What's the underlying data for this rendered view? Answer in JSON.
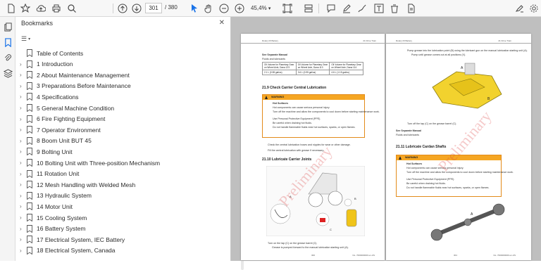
{
  "toolbar": {
    "page_current": "301",
    "page_total": "/ 380",
    "zoom": "45,4%"
  },
  "bookmarks": {
    "title": "Bookmarks",
    "items": [
      {
        "label": "Table of Contents",
        "expandable": false
      },
      {
        "label": "1 Introduction",
        "expandable": true
      },
      {
        "label": "2 About Maintenance Management",
        "expandable": true
      },
      {
        "label": "3 Preparations Before Maintenance",
        "expandable": true
      },
      {
        "label": "4 Specifications",
        "expandable": true
      },
      {
        "label": "5 General Machine Condition",
        "expandable": true
      },
      {
        "label": "6 Fire Fighting Equipment",
        "expandable": true
      },
      {
        "label": "7 Operator Environment",
        "expandable": true
      },
      {
        "label": "8 Boom Unit BUT 45",
        "expandable": true
      },
      {
        "label": "9 Bolting Unit",
        "expandable": true
      },
      {
        "label": "10 Bolting Unit with Three-position Mechanism",
        "expandable": true
      },
      {
        "label": "11 Rotation Unit",
        "expandable": true
      },
      {
        "label": "12 Mesh Handling with Welded Mesh",
        "expandable": true
      },
      {
        "label": "13 Hydraulic System",
        "expandable": true
      },
      {
        "label": "14 Motor Unit",
        "expandable": true
      },
      {
        "label": "15 Cooling System",
        "expandable": true
      },
      {
        "label": "16 Battery System",
        "expandable": true
      },
      {
        "label": "17 Electrical System, IEC Battery",
        "expandable": true
      },
      {
        "label": "18 Electrical System, Canada",
        "expandable": true
      }
    ]
  },
  "doc": {
    "left": {
      "header_left": "Rotary lift Battery",
      "header_right": "21 Drive Train",
      "see_manual": "See Separate Manual",
      "fluids": "Fluids and lubricants",
      "table": [
        [
          "Oil Volume for Planetary Gear on Wheel Axle, Dana 123",
          "Oil Volume for Planetary Gear on Wheel Axle, Dana 113",
          "Oil Volume for Planetary Gear on Wheel Axle, Dana 114"
        ],
        [
          "2.1 L (0.55 gal/us)",
          "3.6 L (0.95 gal/us)",
          "4.6 L (1.15 gal/us)"
        ]
      ],
      "section_a": "21.9   Check Carrier Central Lubrication",
      "warning_head": "WARNING",
      "warn_lines": [
        "Hot Surfaces",
        "Hot components can cause serious personal injury.",
        "Turn off the machine and allow the components to cool down before starting maintenance work.",
        "Use Personal Protective Equipment (PPE).",
        "Be careful when draining hot fluids.",
        "Do not handle flammable fluids near hot surfaces, sparks, or open flames."
      ],
      "check_lines": [
        "Check the central lubrication hoses and nipples for wear or other damage.",
        "Fill the central lubrication with grease if necessary."
      ],
      "section_b": "21.10   Lubricate Carrier Joints",
      "step": "Turn on the tap (C) on the grease barrel (C).",
      "step_sub": "Grease is pumped forward to the manual lubrication starting unit (A).",
      "footer_left": "300",
      "footer_right": "No. 7000000000 en-US",
      "watermark": "Preliminary"
    },
    "right": {
      "header_left": "Rotary lift Battery",
      "header_right": "21 Drive Train",
      "step2": "Pump grease into the lubrication point (B) using the lubricant gun on the manual lubrication starting unit (A).",
      "step2_sub": "Pump until grease comes out at all positions (X).",
      "step3": "Turn off the tap (C) on the grease barrel (C).",
      "see_manual": "See Separate Manual",
      "fluids": "Fluids and lubricants",
      "section": "21.11   Lubricate Cardan Shafts",
      "warning_head": "WARNING",
      "warn_lines": [
        "Hot Surfaces",
        "Hot components can cause serious personal injury.",
        "Turn off the machine and allow the components to cool down before starting maintenance work.",
        "Use Personal Protective Equipment (PPE).",
        "Be careful when draining hot fluids.",
        "Do not handle flammable fluids near hot surfaces, sparks, or open flames."
      ],
      "footer_left": "301",
      "footer_right": "No. 7000000000 en-US",
      "watermark": "Preliminary"
    }
  },
  "colors": {
    "warning": "#f5a623",
    "accent": "#1a73e8",
    "viewer_bg": "#bfbfbf"
  }
}
